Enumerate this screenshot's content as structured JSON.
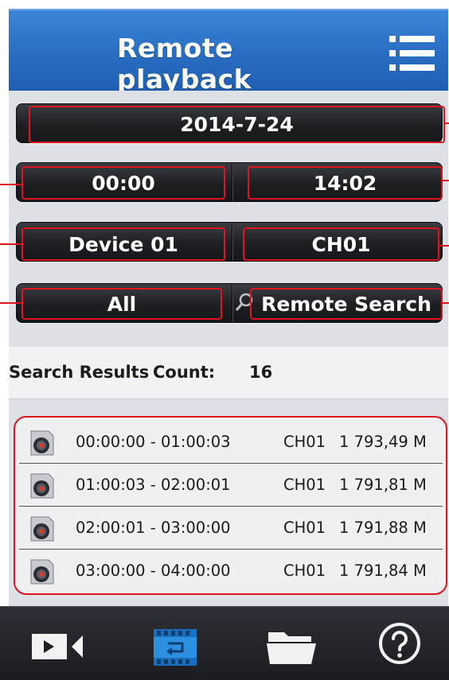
{
  "header": {
    "title": "Remote playback",
    "menu_icon": "hamburger-menu-icon"
  },
  "controls": {
    "date": "2014-7-24",
    "start_time": "00:00",
    "end_time": "14:02",
    "device": "Device 01",
    "channel": "CH01",
    "record_type": "All",
    "search_button": "Remote Search",
    "search_icon": "magnifier-icon"
  },
  "results": {
    "label": "Search Results",
    "count_label": "Count:",
    "count": "16",
    "rows": [
      {
        "time": "00:00:00 - 01:00:03",
        "channel": "CH01",
        "size": "1 793,49 M"
      },
      {
        "time": "01:00:03 - 02:00:01",
        "channel": "CH01",
        "size": "1 791,81 M"
      },
      {
        "time": "02:00:01 - 03:00:00",
        "channel": "CH01",
        "size": "1 791,88 M"
      },
      {
        "time": "03:00:00 - 04:00:00",
        "channel": "CH01",
        "size": "1 791,84 M"
      }
    ]
  },
  "nav": {
    "items": [
      {
        "icon": "live-video-icon",
        "active": false
      },
      {
        "icon": "playback-icon",
        "active": true
      },
      {
        "icon": "folder-icon",
        "active": false
      },
      {
        "icon": "help-icon",
        "active": false
      }
    ]
  },
  "colors": {
    "header": "#2a6fc4",
    "highlight": "#e0141e",
    "active_icon": "#2d8fe0"
  }
}
